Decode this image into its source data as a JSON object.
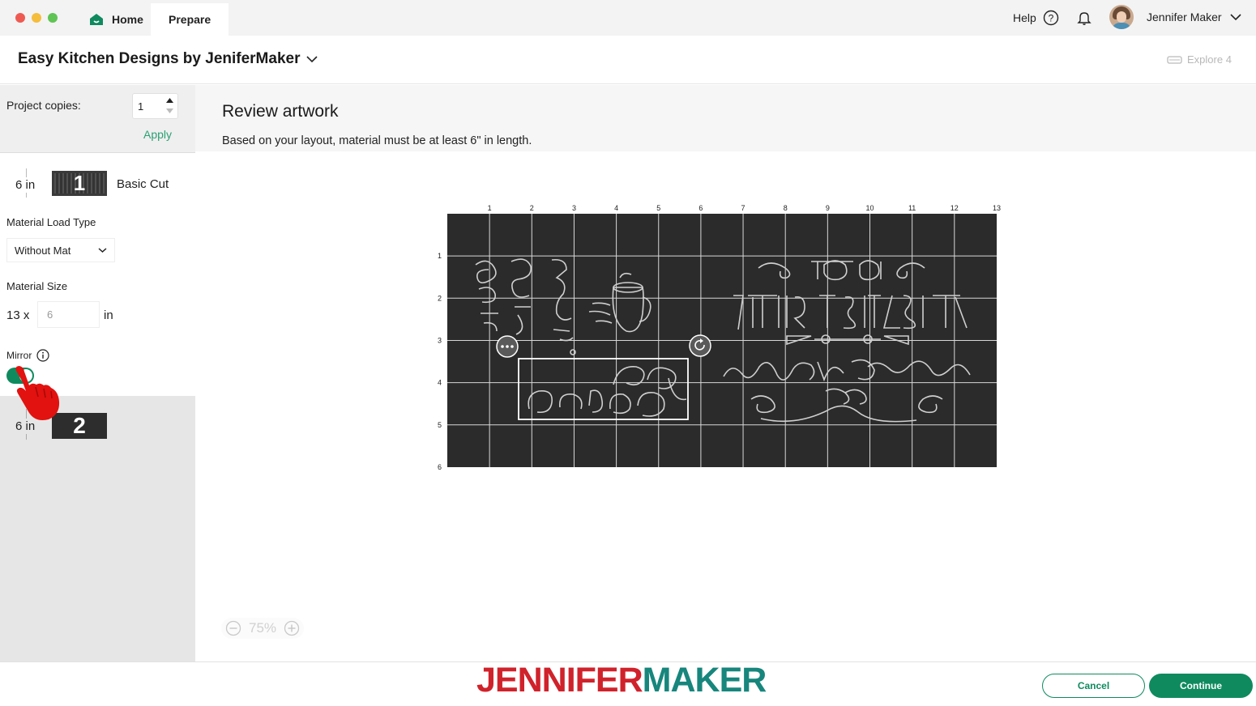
{
  "window": {
    "tabs": [
      {
        "label": "Home"
      },
      {
        "label": "Prepare"
      }
    ],
    "help_label": "Help",
    "user_name": "Jennifer Maker"
  },
  "header": {
    "project_title": "Easy Kitchen Designs by JeniferMaker",
    "machine_label": "Explore 4"
  },
  "sidebar": {
    "copies_label": "Project copies:",
    "copies_value": "1",
    "apply_label": "Apply",
    "mat1": {
      "size_label": "6 in",
      "number": "1",
      "cut_type": "Basic Cut",
      "load_type_label": "Material Load Type",
      "load_type_value": "Without Mat",
      "material_size_label": "Material Size",
      "width_value": "13 x",
      "length_value": "6",
      "unit_label": "in",
      "mirror_label": "Mirror",
      "mirror_on": true
    },
    "mat2": {
      "size_label": "6 in",
      "number": "2"
    }
  },
  "main": {
    "title": "Review artwork",
    "subtitle": "Based on your layout, material must be at least 6\" in length.",
    "ruler_top": [
      "1",
      "2",
      "3",
      "4",
      "5",
      "6",
      "7",
      "8",
      "9",
      "10",
      "11",
      "12",
      "13"
    ],
    "ruler_left": [
      "1",
      "2",
      "3",
      "4",
      "5",
      "6"
    ],
    "zoom_label": "75%"
  },
  "footer": {
    "brand_part1": "JENNIFER",
    "brand_part2": "MAKER",
    "cancel_label": "Cancel",
    "continue_label": "Continue"
  },
  "colors": {
    "accent_green": "#0f8a5f",
    "brand_red": "#d0222b",
    "brand_teal": "#17867d",
    "mat_dark": "#2b2b2b"
  }
}
